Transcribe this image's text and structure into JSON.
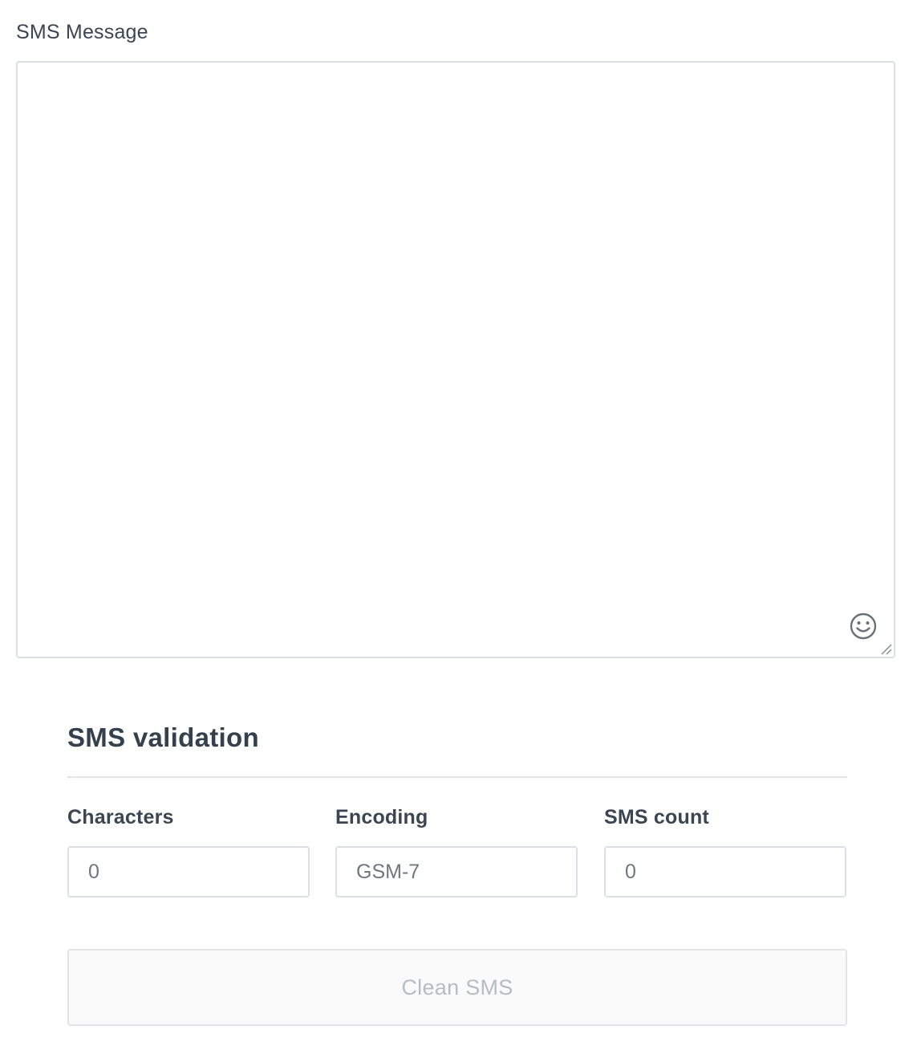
{
  "message": {
    "label": "SMS Message",
    "value": "",
    "emoji_icon": "smiley-face-icon",
    "resize_icon": "resize-grip-icon"
  },
  "validation": {
    "title": "SMS validation",
    "fields": [
      {
        "label": "Characters",
        "value": "0"
      },
      {
        "label": "Encoding",
        "value": "GSM-7"
      },
      {
        "label": "SMS count",
        "value": "0"
      }
    ],
    "clean_button_label": "Clean SMS",
    "clean_button_disabled": true
  }
}
